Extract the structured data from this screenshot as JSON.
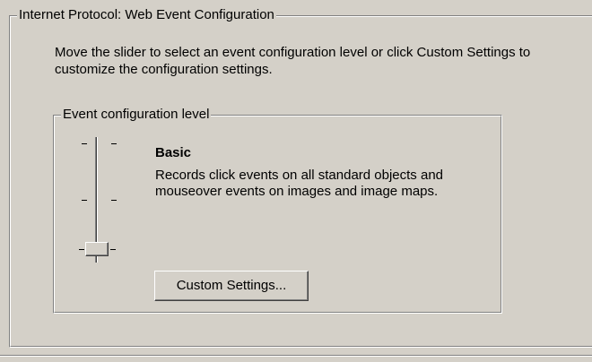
{
  "group": {
    "title": "Internet Protocol: Web Event Configuration"
  },
  "intro": {
    "text": "Move the slider to select an event configuration level or click Custom Settings to customize the configuration settings."
  },
  "level_group": {
    "title": "Event configuration level"
  },
  "slider": {
    "levels": 3,
    "selected_index": 0,
    "selected_level": "Basic"
  },
  "level": {
    "name": "Basic",
    "description": "Records click events on all standard objects and mouseover events on images and image maps."
  },
  "buttons": {
    "custom_settings": "Custom Settings..."
  }
}
